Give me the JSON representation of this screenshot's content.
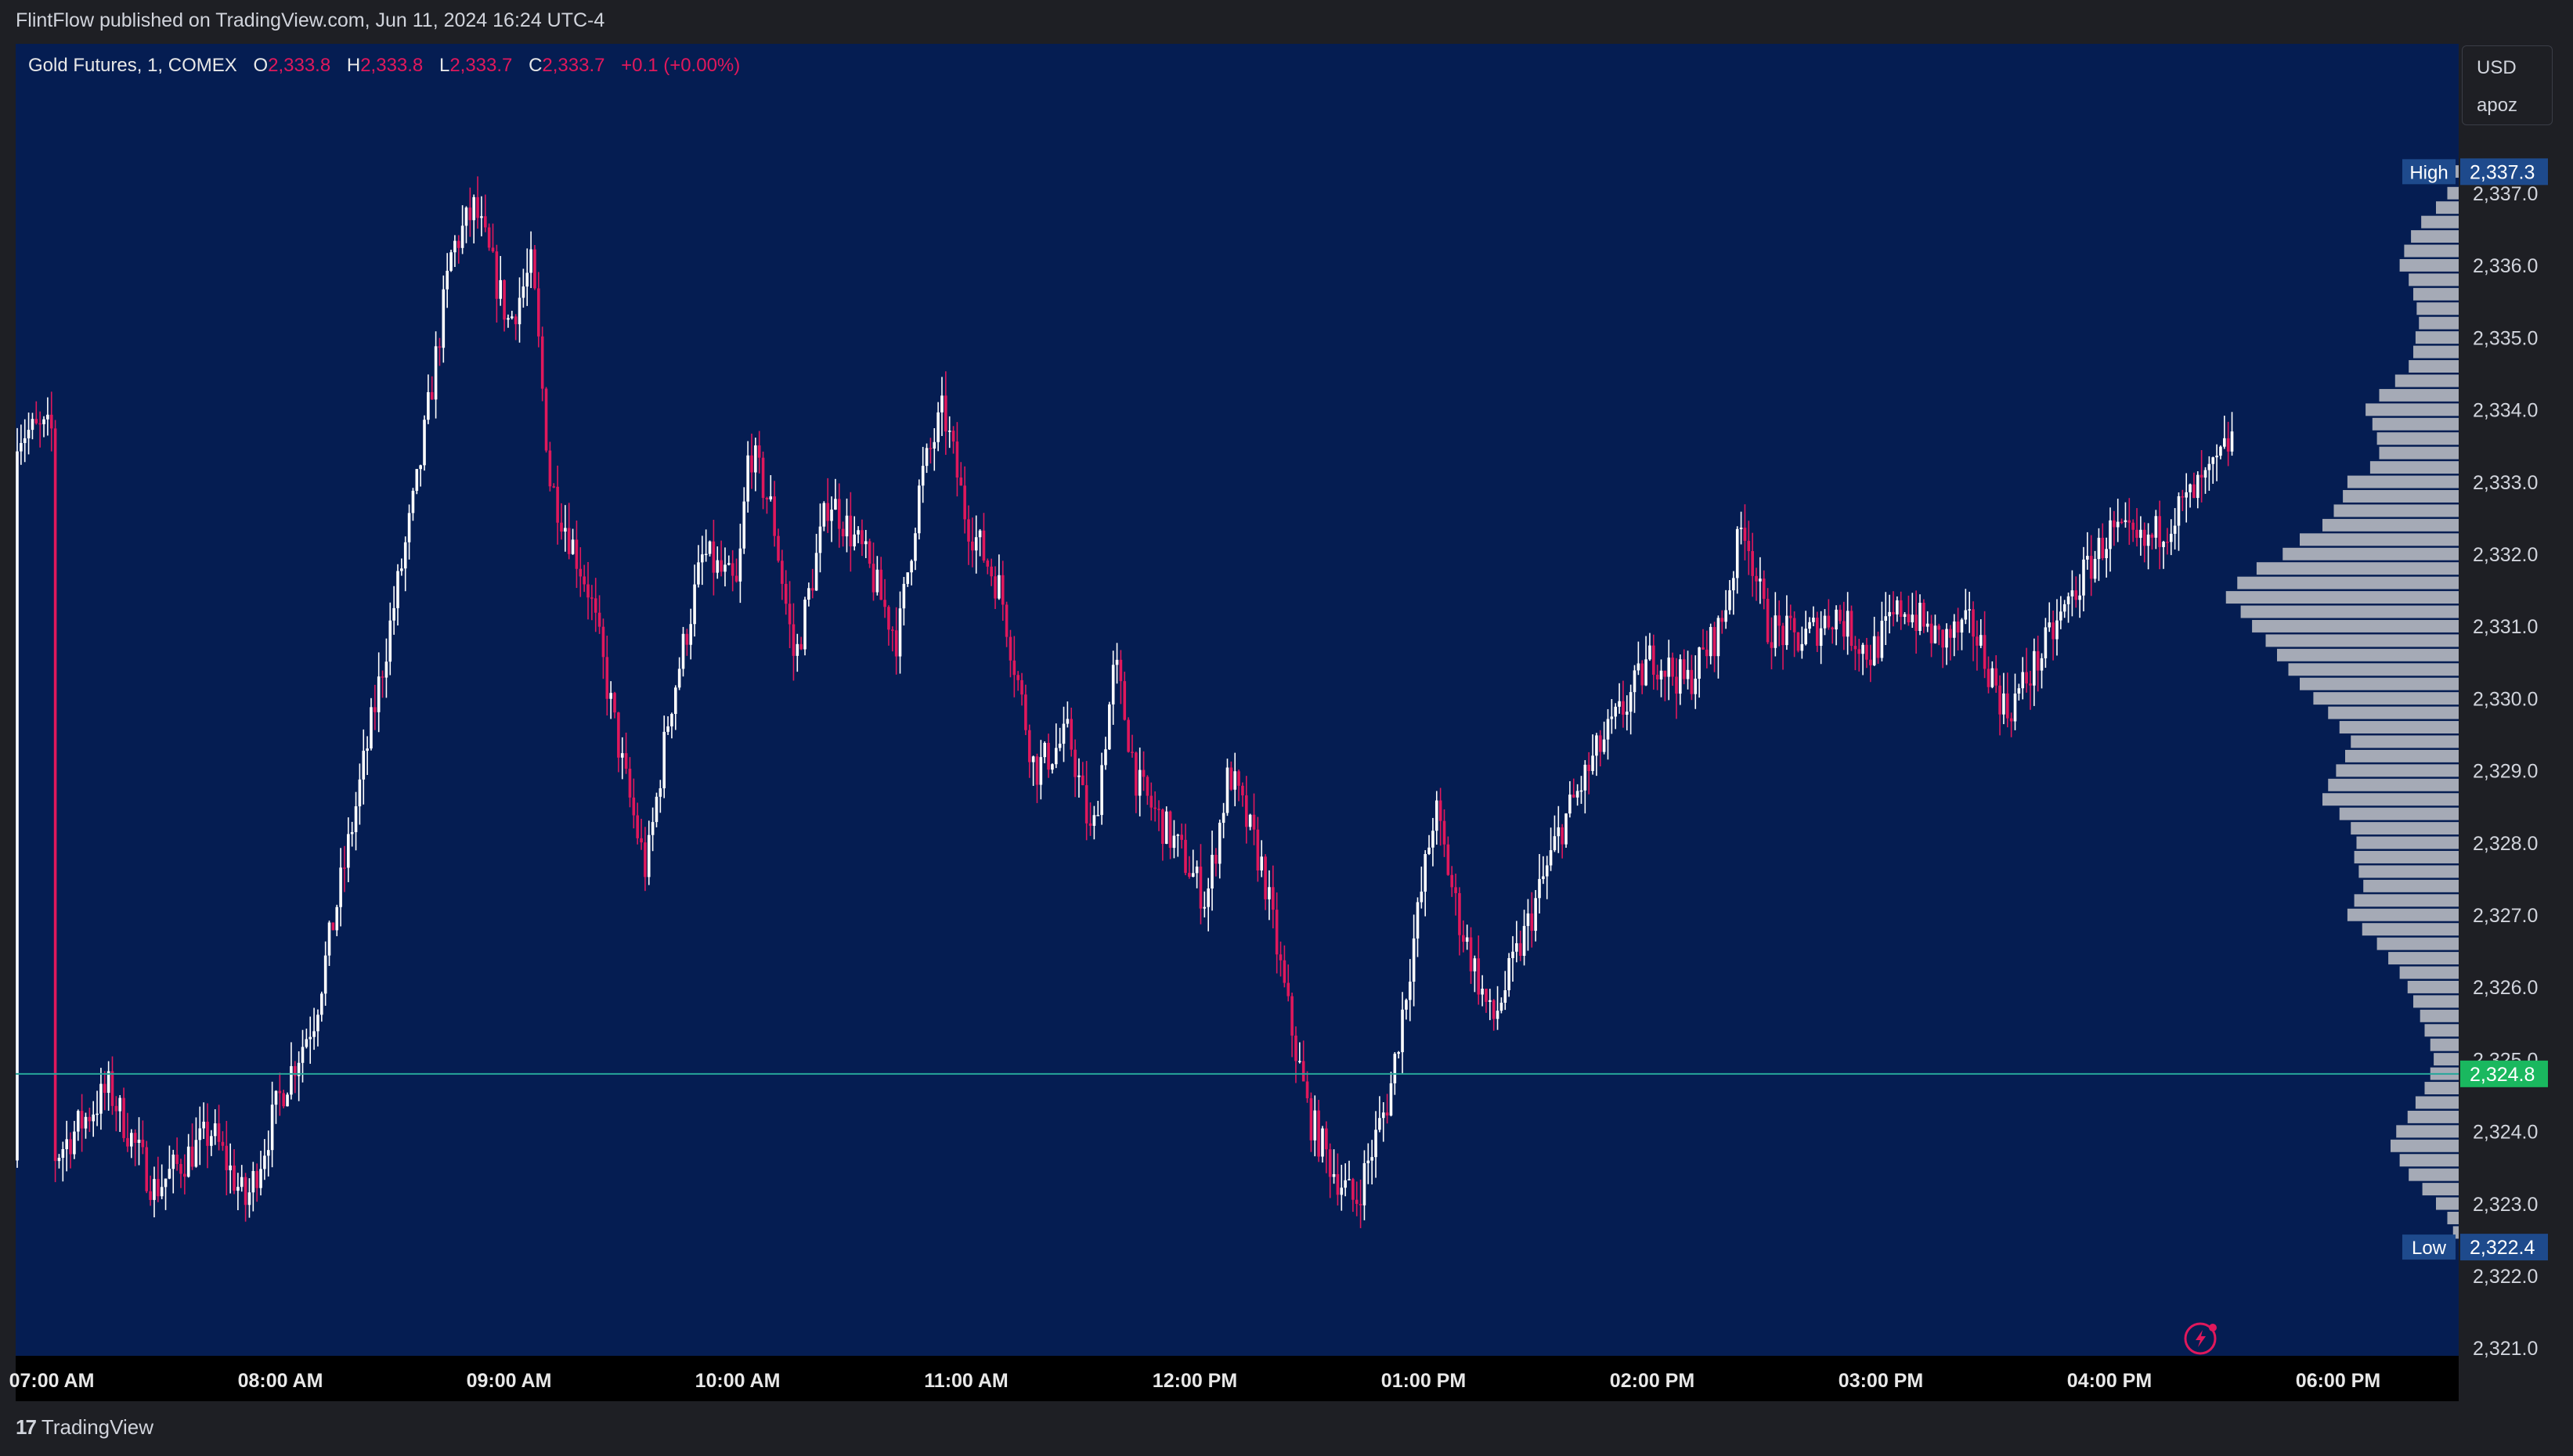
{
  "header": {
    "publish_text": "FlintFlow published on TradingView.com, Jun 11, 2024 16:24 UTC-4"
  },
  "legend": {
    "symbol": "Gold Futures, 1, COMEX",
    "open_label": "O",
    "open": "2,333.8",
    "high_label": "H",
    "high": "2,333.8",
    "low_label": "L",
    "low": "2,333.7",
    "close_label": "C",
    "close": "2,333.7",
    "change": "+0.1 (+0.00%)"
  },
  "scale_box": {
    "currency": "USD",
    "user": "apoz"
  },
  "footer": {
    "brand": "TradingView"
  },
  "colors": {
    "background": "#051d52",
    "up_candle": "#ffffff",
    "down_candle": "#e0185c",
    "volume_profile": "#a5aab6",
    "last_price": "#1ab85f",
    "last_price_line": "#26a69a",
    "high_low_badge": "#1e4a8c"
  },
  "chart_data": {
    "type": "candlestick",
    "title": "Gold Futures, 1, COMEX",
    "x_ticks": [
      "07:00 AM",
      "08:00 AM",
      "09:00 AM",
      "10:00 AM",
      "11:00 AM",
      "12:00 PM",
      "01:00 PM",
      "02:00 PM",
      "03:00 PM",
      "04:00 PM",
      "06:00 PM"
    ],
    "y_ticks": [
      "2,337.0",
      "2,336.0",
      "2,335.0",
      "2,334.0",
      "2,333.0",
      "2,332.0",
      "2,331.0",
      "2,330.0",
      "2,329.0",
      "2,328.0",
      "2,327.0",
      "2,326.0",
      "2,325.0",
      "2,324.0",
      "2,323.0",
      "2,322.0",
      "2,321.0"
    ],
    "ylim": [
      2321.0,
      2338.5
    ],
    "high": {
      "label": "High",
      "value": "2,337.3"
    },
    "low": {
      "label": "Low",
      "value": "2,322.4"
    },
    "last_price": {
      "value": "2,324.8",
      "level": 2324.8
    },
    "price_path": [
      {
        "t": 0.0,
        "p": 2323.6
      },
      {
        "t": 0.25,
        "p": 2324.6
      },
      {
        "t": 0.45,
        "p": 2323.2
      },
      {
        "t": 0.7,
        "p": 2324.0
      },
      {
        "t": 0.85,
        "p": 2323.0
      },
      {
        "t": 1.0,
        "p": 2324.5
      },
      {
        "t": 1.15,
        "p": 2325.6
      },
      {
        "t": 1.3,
        "p": 2328.0
      },
      {
        "t": 1.45,
        "p": 2330.5
      },
      {
        "t": 1.6,
        "p": 2333.0
      },
      {
        "t": 1.75,
        "p": 2336.2
      },
      {
        "t": 1.85,
        "p": 2336.8
      },
      {
        "t": 2.0,
        "p": 2335.2
      },
      {
        "t": 2.1,
        "p": 2336.0
      },
      {
        "t": 2.18,
        "p": 2333.0
      },
      {
        "t": 2.35,
        "p": 2331.5
      },
      {
        "t": 2.5,
        "p": 2329.0
      },
      {
        "t": 2.6,
        "p": 2327.6
      },
      {
        "t": 2.7,
        "p": 2329.8
      },
      {
        "t": 2.85,
        "p": 2332.0
      },
      {
        "t": 3.0,
        "p": 2331.5
      },
      {
        "t": 3.05,
        "p": 2333.5
      },
      {
        "t": 3.15,
        "p": 2332.6
      },
      {
        "t": 3.25,
        "p": 2330.5
      },
      {
        "t": 3.4,
        "p": 2332.8
      },
      {
        "t": 3.55,
        "p": 2332.0
      },
      {
        "t": 3.7,
        "p": 2330.8
      },
      {
        "t": 3.8,
        "p": 2333.0
      },
      {
        "t": 3.9,
        "p": 2334.0
      },
      {
        "t": 4.0,
        "p": 2332.5
      },
      {
        "t": 4.15,
        "p": 2331.5
      },
      {
        "t": 4.3,
        "p": 2329.0
      },
      {
        "t": 4.45,
        "p": 2329.5
      },
      {
        "t": 4.55,
        "p": 2328.0
      },
      {
        "t": 4.65,
        "p": 2330.5
      },
      {
        "t": 4.75,
        "p": 2328.8
      },
      {
        "t": 4.95,
        "p": 2327.8
      },
      {
        "t": 5.05,
        "p": 2327.2
      },
      {
        "t": 5.15,
        "p": 2329.0
      },
      {
        "t": 5.3,
        "p": 2327.6
      },
      {
        "t": 5.4,
        "p": 2325.8
      },
      {
        "t": 5.5,
        "p": 2324.2
      },
      {
        "t": 5.6,
        "p": 2323.5
      },
      {
        "t": 5.7,
        "p": 2323.0
      },
      {
        "t": 5.85,
        "p": 2324.5
      },
      {
        "t": 5.95,
        "p": 2326.5
      },
      {
        "t": 6.05,
        "p": 2328.5
      },
      {
        "t": 6.15,
        "p": 2327.0
      },
      {
        "t": 6.3,
        "p": 2325.5
      },
      {
        "t": 6.45,
        "p": 2326.8
      },
      {
        "t": 6.6,
        "p": 2328.2
      },
      {
        "t": 6.75,
        "p": 2329.2
      },
      {
        "t": 6.9,
        "p": 2330.0
      },
      {
        "t": 7.0,
        "p": 2330.6
      },
      {
        "t": 7.15,
        "p": 2330.2
      },
      {
        "t": 7.3,
        "p": 2331.0
      },
      {
        "t": 7.4,
        "p": 2332.5
      },
      {
        "t": 7.5,
        "p": 2331.0
      },
      {
        "t": 7.65,
        "p": 2330.8
      },
      {
        "t": 7.8,
        "p": 2331.2
      },
      {
        "t": 7.95,
        "p": 2330.6
      },
      {
        "t": 8.1,
        "p": 2331.3
      },
      {
        "t": 8.25,
        "p": 2330.8
      },
      {
        "t": 8.4,
        "p": 2331.0
      },
      {
        "t": 8.55,
        "p": 2329.8
      },
      {
        "t": 8.7,
        "p": 2330.6
      },
      {
        "t": 8.85,
        "p": 2331.5
      },
      {
        "t": 9.0,
        "p": 2332.3
      },
      {
        "t": 9.15,
        "p": 2332.1
      },
      {
        "t": 9.3,
        "p": 2332.6
      },
      {
        "t": 9.45,
        "p": 2333.1
      },
      {
        "t": 9.55,
        "p": 2333.7
      }
    ],
    "volume_profile": [
      [
        2337.3,
        0.05
      ],
      [
        2337.0,
        0.1
      ],
      [
        2336.8,
        0.2
      ],
      [
        2336.6,
        0.33
      ],
      [
        2336.4,
        0.42
      ],
      [
        2336.2,
        0.48
      ],
      [
        2336.0,
        0.52
      ],
      [
        2335.8,
        0.44
      ],
      [
        2335.6,
        0.4
      ],
      [
        2335.4,
        0.37
      ],
      [
        2335.2,
        0.35
      ],
      [
        2335.0,
        0.38
      ],
      [
        2334.8,
        0.4
      ],
      [
        2334.6,
        0.44
      ],
      [
        2334.4,
        0.56
      ],
      [
        2334.2,
        0.7
      ],
      [
        2334.0,
        0.82
      ],
      [
        2333.8,
        0.76
      ],
      [
        2333.6,
        0.72
      ],
      [
        2333.4,
        0.7
      ],
      [
        2333.2,
        0.78
      ],
      [
        2333.0,
        0.98
      ],
      [
        2332.8,
        1.02
      ],
      [
        2332.6,
        1.1
      ],
      [
        2332.4,
        1.2
      ],
      [
        2332.2,
        1.4
      ],
      [
        2332.0,
        1.55
      ],
      [
        2331.8,
        1.78
      ],
      [
        2331.6,
        1.95
      ],
      [
        2331.4,
        2.05
      ],
      [
        2331.2,
        1.92
      ],
      [
        2331.0,
        1.82
      ],
      [
        2330.8,
        1.7
      ],
      [
        2330.6,
        1.6
      ],
      [
        2330.4,
        1.5
      ],
      [
        2330.2,
        1.4
      ],
      [
        2330.0,
        1.28
      ],
      [
        2329.8,
        1.15
      ],
      [
        2329.6,
        1.05
      ],
      [
        2329.4,
        0.95
      ],
      [
        2329.2,
        1.0
      ],
      [
        2329.0,
        1.08
      ],
      [
        2328.8,
        1.15
      ],
      [
        2328.6,
        1.2
      ],
      [
        2328.4,
        1.05
      ],
      [
        2328.2,
        0.95
      ],
      [
        2328.0,
        0.9
      ],
      [
        2327.8,
        0.92
      ],
      [
        2327.6,
        0.88
      ],
      [
        2327.4,
        0.84
      ],
      [
        2327.2,
        0.92
      ],
      [
        2327.0,
        0.98
      ],
      [
        2326.8,
        0.85
      ],
      [
        2326.6,
        0.72
      ],
      [
        2326.4,
        0.62
      ],
      [
        2326.2,
        0.52
      ],
      [
        2326.0,
        0.45
      ],
      [
        2325.8,
        0.4
      ],
      [
        2325.6,
        0.34
      ],
      [
        2325.4,
        0.3
      ],
      [
        2325.2,
        0.25
      ],
      [
        2325.0,
        0.22
      ],
      [
        2324.8,
        0.25
      ],
      [
        2324.6,
        0.3
      ],
      [
        2324.4,
        0.38
      ],
      [
        2324.2,
        0.45
      ],
      [
        2324.0,
        0.55
      ],
      [
        2323.8,
        0.6
      ],
      [
        2323.6,
        0.52
      ],
      [
        2323.4,
        0.44
      ],
      [
        2323.2,
        0.32
      ],
      [
        2323.0,
        0.2
      ],
      [
        2322.8,
        0.1
      ],
      [
        2322.6,
        0.05
      ]
    ]
  }
}
